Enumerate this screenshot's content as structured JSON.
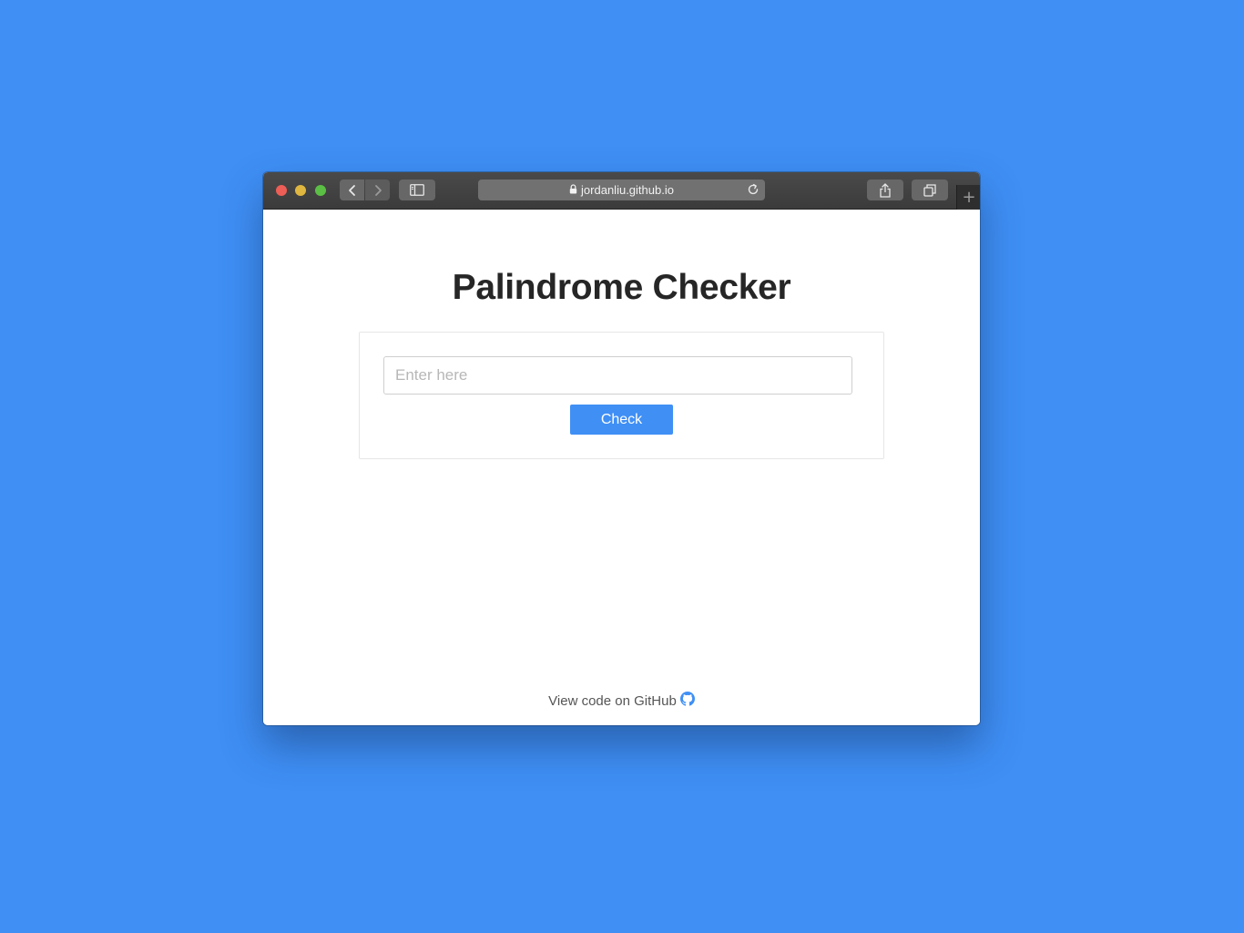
{
  "colors": {
    "desktop_background": "#3f8ff5",
    "accent": "#3f8ff5",
    "title_text": "#262626"
  },
  "browser": {
    "url": "jordanliu.github.io",
    "icons": {
      "back": "chevron-left-icon",
      "forward": "chevron-right-icon",
      "sidebar": "sidebar-icon",
      "lock": "lock-icon",
      "reload": "reload-icon",
      "share": "share-icon",
      "tabs": "tabs-overview-icon",
      "new_tab": "plus-icon"
    },
    "new_tab_glyph": "+"
  },
  "page": {
    "title": "Palindrome Checker",
    "input": {
      "placeholder": "Enter here",
      "value": ""
    },
    "check_button_label": "Check",
    "footer": {
      "link_text": "View code on GitHub",
      "icon": "github-icon"
    }
  }
}
